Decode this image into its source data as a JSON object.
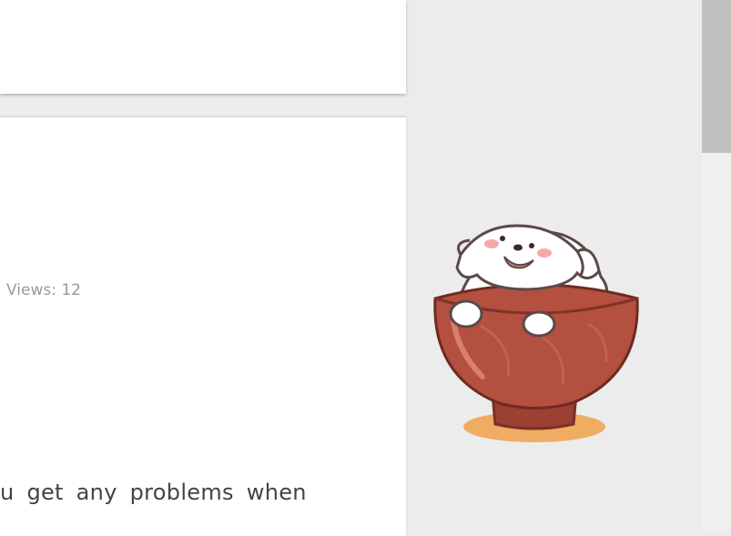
{
  "post": {
    "views": "Views: 12",
    "body_snippet": "u get any problems when"
  },
  "mascot": {
    "icon": "dog-in-bowl-icon",
    "colors": {
      "bowl": "#b4503f",
      "dog": "#ffffff",
      "plate": "#f0a14a"
    }
  }
}
